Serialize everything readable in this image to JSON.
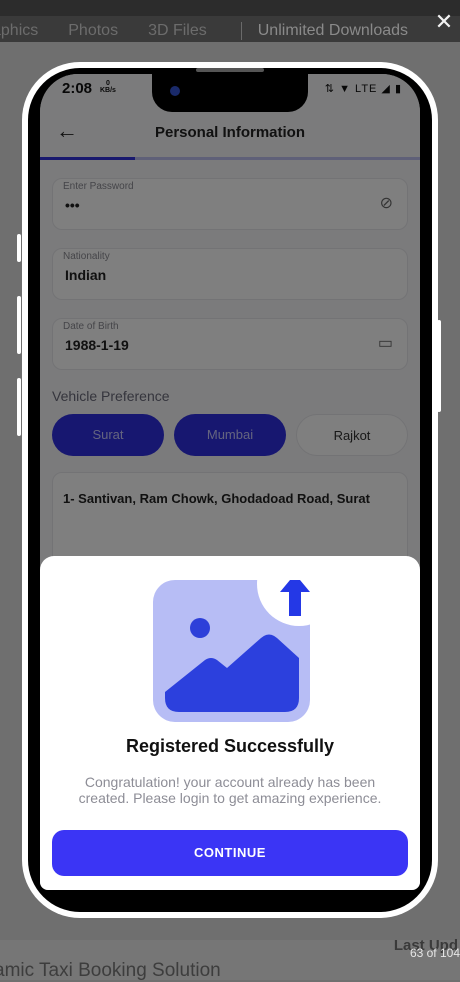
{
  "background": {
    "nav_items": [
      "aphics",
      "Photos",
      "3D Files"
    ],
    "unlimited_label": "Unlimited Downloads",
    "bottom_title": "amic Taxi Booking Solution",
    "last_label": "Last Upd",
    "counter": "63 of 104",
    "close_glyph": "✕"
  },
  "status_bar": {
    "time": "2:08",
    "speed_value": "0",
    "speed_unit": "KB/s",
    "icons": "⇅ ▼ LTE ◢ ▮"
  },
  "app": {
    "title": "Personal Information",
    "back_glyph": "←",
    "progress_fraction": 0.25,
    "fields": [
      {
        "label": "Enter Password",
        "value": "•••",
        "icon": "eye-off-icon",
        "glyph": "⊘"
      },
      {
        "label": "Nationality",
        "value": "Indian"
      },
      {
        "label": "Date of Birth",
        "value": "1988-1-19",
        "icon": "calendar-icon",
        "glyph": "▭"
      }
    ],
    "vehicle_preference_label": "Vehicle Preference",
    "chips": [
      {
        "label": "Surat",
        "selected": true
      },
      {
        "label": "Mumbai",
        "selected": true
      },
      {
        "label": "Rajkot",
        "selected": false
      }
    ],
    "address": "1- Santivan, Ram Chowk, Ghodadoad Road, Surat"
  },
  "dialog": {
    "icon": "image-upload-icon",
    "title": "Registered Successfully",
    "message": "Congratulation! your account already has been created. Please login to get amazing experience.",
    "button_label": "CONTINUE"
  },
  "colors": {
    "accent": "#3b35f5",
    "chip_selected": "#2f2fe0",
    "illustration_light": "#b7bdf5",
    "illustration_dark": "#2336d8"
  }
}
